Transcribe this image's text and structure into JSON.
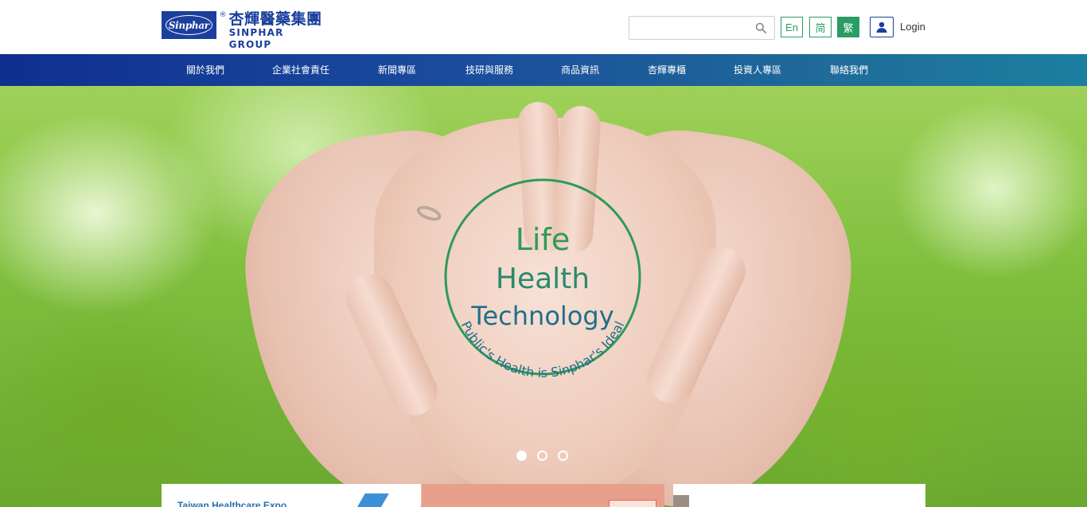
{
  "header": {
    "logo_badge": "Sinphar",
    "logo_reg": "®",
    "logo_cn": "杏輝醫藥集團",
    "logo_en": "SINPHAR GROUP",
    "search_placeholder": "",
    "lang_en": "En",
    "lang_sc": "简",
    "lang_tc": "繁",
    "login_label": "Login"
  },
  "nav": {
    "items": [
      {
        "label": "關於我們"
      },
      {
        "label": "企業社會責任"
      },
      {
        "label": "新聞專區"
      },
      {
        "label": "技研與服務"
      },
      {
        "label": "商品資訊"
      },
      {
        "label": "杏輝專櫃"
      },
      {
        "label": "投資人專區"
      },
      {
        "label": "聯絡我們"
      }
    ]
  },
  "hero": {
    "seal_line1": "Life",
    "seal_line2": "Health",
    "seal_line3": "Technology",
    "seal_arc": "Public's Health is Sinphar's Ideal",
    "slides_total": 3,
    "slide_active": 1
  },
  "cards": {
    "card1_text": "Taiwan Healthcare Expo"
  },
  "colors": {
    "brand_blue": "#1b3f9c",
    "accent_green": "#2a9d63",
    "seal_green": "#2e9a5a",
    "seal_teal": "#1f6f8a"
  }
}
